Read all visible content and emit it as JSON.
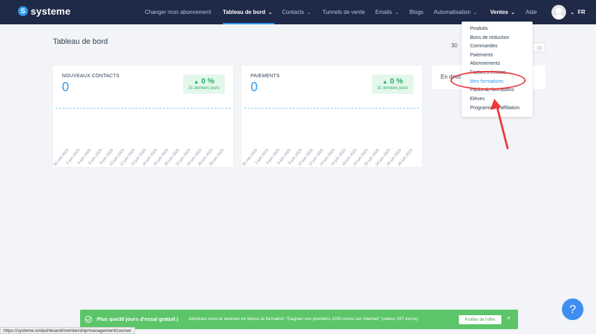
{
  "header": {
    "logo_text": "systeme",
    "logo_mark": "S",
    "nav": [
      {
        "label": "Changer mon abonnement",
        "chevron": false
      },
      {
        "label": "Tableau de bord",
        "chevron": true
      },
      {
        "label": "Contacts",
        "chevron": true
      },
      {
        "label": "Tunnels de vente",
        "chevron": false
      },
      {
        "label": "Emails",
        "chevron": true
      },
      {
        "label": "Blogs",
        "chevron": false
      },
      {
        "label": "Automatisation",
        "chevron": true
      },
      {
        "label": "Ventes",
        "chevron": true
      },
      {
        "label": "Aide",
        "chevron": false
      }
    ],
    "lang": "FR",
    "chevron_glyph": "⌄"
  },
  "page": {
    "title": "Tableau de bord",
    "range_prefix": "30"
  },
  "cards": [
    {
      "label": "NOUVEAUX CONTACTS",
      "value": "0",
      "change": "0 %",
      "period": "31 derniers jours",
      "ticks": [
        "30 mai 2020",
        "2 juin 2020",
        "4 juin 2020",
        "6 juin 2020",
        "8 juin 2020",
        "10 juin 2020",
        "12 juin 2020",
        "14 juin 2020",
        "16 juin 2020",
        "18 juin 2020",
        "20 juin 2020",
        "22 juin 2020",
        "24 juin 2020",
        "26 juin 2020",
        "28 juin 2020"
      ]
    },
    {
      "label": "PAIEMENTS",
      "value": "0",
      "change": "0 %",
      "period": "31 derniers jours",
      "ticks": [
        "30 mai 2020",
        "2 juin 2020",
        "4 juin 2020",
        "6 juin 2020",
        "8 juin 2020",
        "10 juin 2020",
        "12 juin 2020",
        "14 juin 2020",
        "16 juin 2020",
        "18 juin 2020",
        "20 juin 2020",
        "22 juin 2020",
        "24 juin 2020",
        "26 juin 2020",
        "28 juin 2020"
      ]
    }
  ],
  "live": {
    "label": "En direct"
  },
  "dropdown": {
    "items": [
      "Produits",
      "Bons de réduction",
      "Commandes",
      "Paiements",
      "Abonnements",
      "Factures émises",
      "Mes formations",
      "Packs de formations",
      "Elèves",
      "Programme d'affiliation"
    ],
    "highlighted_index": 6
  },
  "promo": {
    "bold": "Plus que30 jours d'essai gratuit |",
    "text": "Abonnez-vous et recevez en bonus la formation \"Gagnez vos premiers 1000 euros sur Internet\" (valeur 297 euros)",
    "button": "Profiter de l'offre",
    "close": "×"
  },
  "help": {
    "label": "?"
  },
  "status_bar": {
    "url": "https://systeme.io/dashboard/membership/management/course/"
  },
  "colors": {
    "header_bg": "#1f2a48",
    "accent": "#2e9bf0",
    "success": "#27ae60",
    "promo_bg": "#5cc56a",
    "annotation": "#ec3a3a"
  }
}
